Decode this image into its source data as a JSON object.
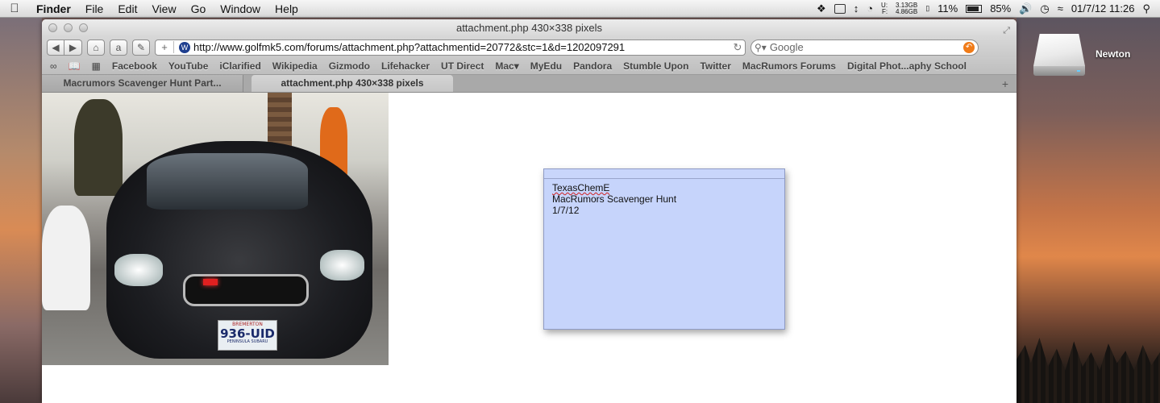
{
  "menubar": {
    "app": "Finder",
    "items": [
      "File",
      "Edit",
      "View",
      "Go",
      "Window",
      "Help"
    ],
    "status": {
      "disk_used": "3.13GB",
      "disk_free": "4.86GB",
      "disk_used_label": "U:",
      "disk_free_label": "F:",
      "cpu": "11%",
      "battery": "85%",
      "datetime": "01/7/12 11:26"
    }
  },
  "window": {
    "title": "attachment.php 430×338 pixels",
    "url": "http://www.golfmk5.com/forums/attachment.php?attachmentid=20772&stc=1&d=1202097291",
    "search_placeholder": "Google",
    "bookmarks": [
      "Facebook",
      "YouTube",
      "iClarified",
      "Wikipedia",
      "Gizmodo",
      "Lifehacker",
      "UT Direct",
      "Mac▾",
      "MyEdu",
      "Pandora",
      "Stumble Upon",
      "Twitter",
      "MacRumors Forums",
      "Digital Phot...aphy School"
    ],
    "tabs": [
      {
        "label": "Macrumors Scavenger Hunt Part..."
      },
      {
        "label": "attachment.php 430×338 pixels"
      }
    ]
  },
  "photo": {
    "plate_top": "BREMERTON",
    "plate_number": "936-UID",
    "plate_bottom": "PENINSULA  SUBARU"
  },
  "note": {
    "lines": [
      "TexasChemE",
      "MacRumors Scavenger Hunt",
      "1/7/12"
    ]
  },
  "desktop": {
    "drive_label": "Newton"
  }
}
